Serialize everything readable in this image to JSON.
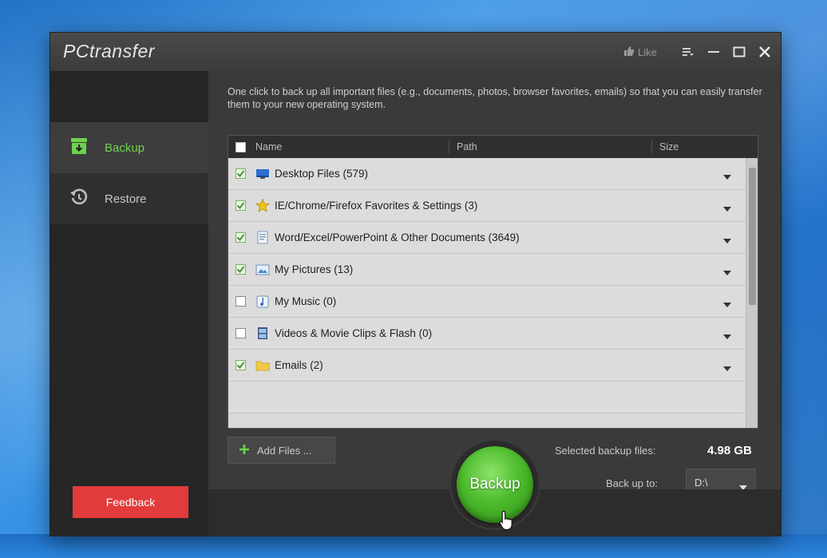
{
  "window": {
    "title": "PCtransfer",
    "like_label": "Like"
  },
  "sidebar": {
    "items": [
      {
        "label": "Backup",
        "icon": "archive-download-icon",
        "active": true
      },
      {
        "label": "Restore",
        "icon": "history-icon",
        "active": false
      }
    ],
    "feedback_label": "Feedback"
  },
  "main": {
    "description": "One click to back up all important files (e.g., documents, photos, browser favorites, emails) so that you can easily transfer them to your new operating system.",
    "table": {
      "columns": [
        "Name",
        "Path",
        "Size"
      ],
      "rows": [
        {
          "label": "Desktop Files (579)",
          "checked": true,
          "icon": "desktop-icon"
        },
        {
          "label": "IE/Chrome/Firefox Favorites & Settings (3)",
          "checked": true,
          "icon": "star-icon"
        },
        {
          "label": "Word/Excel/PowerPoint & Other Documents (3649)",
          "checked": true,
          "icon": "document-icon"
        },
        {
          "label": "My Pictures (13)",
          "checked": true,
          "icon": "picture-icon"
        },
        {
          "label": "My Music (0)",
          "checked": false,
          "icon": "music-icon"
        },
        {
          "label": "Videos & Movie Clips & Flash (0)",
          "checked": false,
          "icon": "film-icon"
        },
        {
          "label": "Emails (2)",
          "checked": true,
          "icon": "folder-icon"
        }
      ]
    },
    "add_files_label": "Add Files ...",
    "selected_label": "Selected backup files:",
    "selected_value": "4.98 GB",
    "backup_to_label": "Back up to:",
    "drive_value": "D:\\",
    "backup_button": "Backup"
  },
  "colors": {
    "accent_green": "#6fd34e",
    "feedback_red": "#e23b3b",
    "window_dark": "#3a3a3a"
  }
}
